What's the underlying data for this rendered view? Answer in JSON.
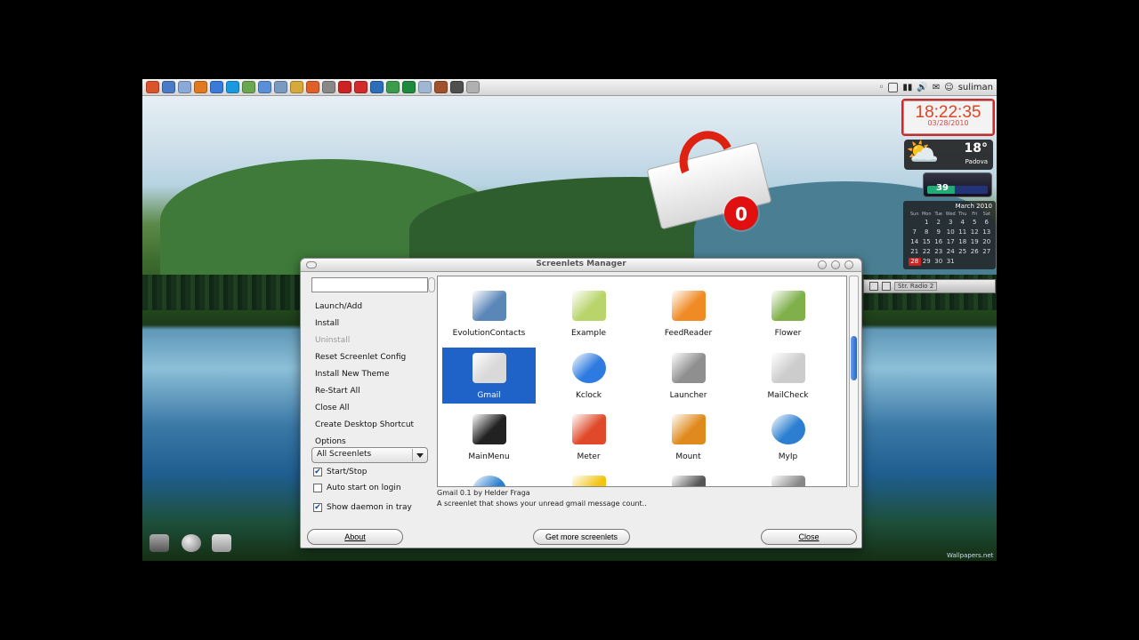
{
  "top_panel": {
    "launcher_colors": [
      "#d9532c",
      "#4b7bc7",
      "#8aa9d6",
      "#e07a1e",
      "#3b7ad9",
      "#1a99e0",
      "#6aa84f",
      "#5a8fd8",
      "#7a9ac0",
      "#d7a83a",
      "#e0602a",
      "#888888",
      "#cc2222",
      "#d22b2b",
      "#2c6fb8",
      "#3c9c4c",
      "#1e8a3e",
      "#9fb7d3",
      "#a0522d",
      "#4f4f4f",
      "#b0b0b0"
    ],
    "username": "suliman"
  },
  "clock": {
    "time": "18:22:35",
    "date": "03/28/2010"
  },
  "weather": {
    "icon": "⛅",
    "temp": "18°",
    "city": "Padova"
  },
  "meter": {
    "value": "39"
  },
  "calendar": {
    "title": "March 2010",
    "weekdays": [
      "Sun",
      "Mon",
      "Tue",
      "Wed",
      "Thu",
      "Fri",
      "Sat"
    ],
    "days": [
      "",
      "1",
      "2",
      "3",
      "4",
      "5",
      "6",
      "7",
      "8",
      "9",
      "10",
      "11",
      "12",
      "13",
      "14",
      "15",
      "16",
      "17",
      "18",
      "19",
      "20",
      "21",
      "22",
      "23",
      "24",
      "25",
      "26",
      "27",
      "28",
      "29",
      "30",
      "31"
    ],
    "today": "28"
  },
  "gmail_widget": {
    "count": "0"
  },
  "player": {
    "label": "Str. Radio 2"
  },
  "wallpaper_credit": "Wallpapers.net",
  "screenlets_manager": {
    "title": "Screenlets Manager",
    "search_value": "",
    "actions": [
      {
        "label": "Launch/Add",
        "enabled": true
      },
      {
        "label": "Install",
        "enabled": true
      },
      {
        "label": "Uninstall",
        "enabled": false
      },
      {
        "label": "Reset Screenlet Config",
        "enabled": true
      },
      {
        "label": "Install New Theme",
        "enabled": true
      },
      {
        "label": "Re-Start All",
        "enabled": true
      },
      {
        "label": "Close All",
        "enabled": true
      },
      {
        "label": "Create Desktop Shortcut",
        "enabled": true
      },
      {
        "label": "Options",
        "enabled": true
      }
    ],
    "filter": "All Screenlets",
    "checkboxes": [
      {
        "label": "Start/Stop",
        "checked": true
      },
      {
        "label": "Auto start on login",
        "checked": false
      },
      {
        "label": "Show daemon in tray",
        "checked": true
      }
    ],
    "screenlets": [
      {
        "label": "EvolutionContacts",
        "icon": "photo-frame-icon",
        "color": "#5b86b8"
      },
      {
        "label": "Example",
        "icon": "fish-icon",
        "color": "#b9d46a"
      },
      {
        "label": "FeedReader",
        "icon": "feed-icon",
        "color": "#f08a24"
      },
      {
        "label": "Flower",
        "icon": "flower-icon",
        "color": "#7fb04a"
      },
      {
        "label": "Gmail",
        "icon": "gmail-icon",
        "color": "#d9d9d9"
      },
      {
        "label": "Kclock",
        "icon": "orb-icon",
        "color": "#2d7be0"
      },
      {
        "label": "Launcher",
        "icon": "x-icon",
        "color": "#8f8f8f"
      },
      {
        "label": "MailCheck",
        "icon": "envelope-icon",
        "color": "#cccccc"
      },
      {
        "label": "MainMenu",
        "icon": "gnome-foot-icon",
        "color": "#222222"
      },
      {
        "label": "Meter",
        "icon": "meter-icon",
        "color": "#e04a2a"
      },
      {
        "label": "Mount",
        "icon": "drive-icon",
        "color": "#e08a1e"
      },
      {
        "label": "MyIp",
        "icon": "globe-icon",
        "color": "#2c7fd0"
      },
      {
        "label": "",
        "icon": "globe-icon",
        "color": "#2c7fd0"
      },
      {
        "label": "",
        "icon": "note-icon",
        "color": "#f2c40f"
      },
      {
        "label": "",
        "icon": "dots-icon",
        "color": "#555555"
      },
      {
        "label": "",
        "icon": "paper-icon",
        "color": "#888888"
      }
    ],
    "selected_index": 4,
    "description": {
      "title": "Gmail 0.1 by Helder Fraga",
      "text": "A screenlet that shows your unread gmail message count.."
    },
    "buttons": {
      "about": "About",
      "get_more": "Get more screenlets",
      "close": "Close"
    }
  }
}
